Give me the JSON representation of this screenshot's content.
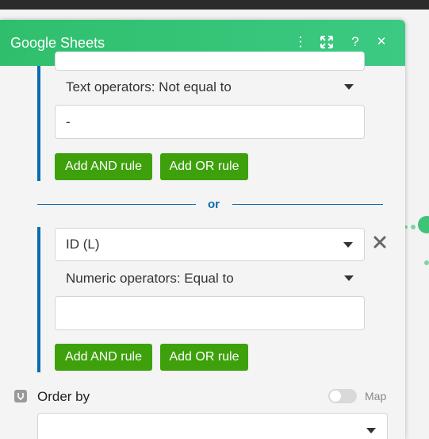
{
  "panel": {
    "title": "Google Sheets",
    "header_icons": [
      "more-vertical-icon",
      "expand-icon",
      "help-icon",
      "close-icon"
    ],
    "header_glyphs": {
      "more": "⋮",
      "help": "?",
      "close": "✕"
    }
  },
  "rule_group_1": {
    "operator": "Text operators: Not equal to",
    "value": "-",
    "add_and_label": "Add AND rule",
    "add_or_label": "Add OR rule"
  },
  "separator": {
    "label": "or"
  },
  "rule_group_2": {
    "field": "ID (L)",
    "operator": "Numeric operators: Equal to",
    "value": "",
    "add_and_label": "Add AND rule",
    "add_or_label": "Add OR rule"
  },
  "order_by": {
    "label": "Order by",
    "map_label": "Map",
    "map_enabled": false,
    "selected": ""
  },
  "colors": {
    "header_green": "#2fbf6c",
    "button_green": "#3ea10c",
    "accent_blue": "#0b6bb0"
  }
}
